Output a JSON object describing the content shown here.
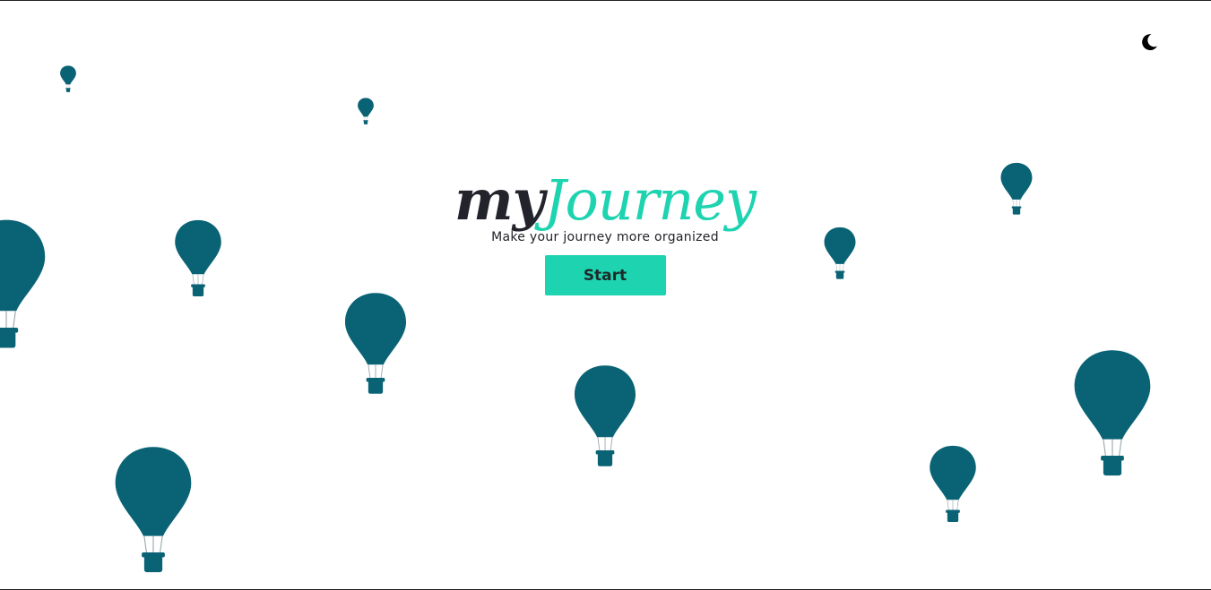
{
  "colors": {
    "balloon": "#0a6375",
    "accent": "#1dd3b0",
    "text": "#23232b",
    "background": "#ffffff"
  },
  "header": {
    "theme_toggle_icon": "moon-icon"
  },
  "hero": {
    "logo_part1": "my",
    "logo_part2": "Journey",
    "tagline": "Make your journey more organized",
    "start_label": "Start"
  },
  "decorations": {
    "balloon_icon": "hot-air-balloon-icon"
  }
}
